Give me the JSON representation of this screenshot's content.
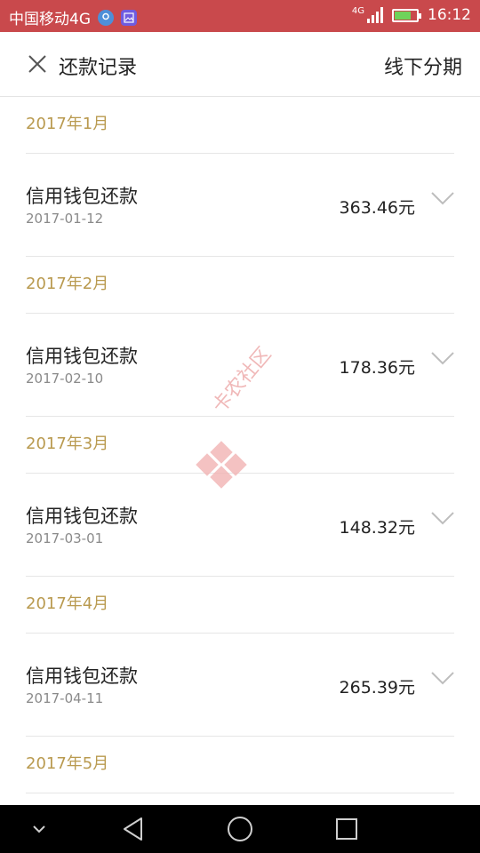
{
  "status_bar": {
    "carrier": "中国移动4G",
    "network": "4G",
    "time": "16:12"
  },
  "header": {
    "title": "还款记录",
    "right_link": "线下分期"
  },
  "sections": [
    {
      "month": "2017年1月",
      "records": [
        {
          "title": "信用钱包还款",
          "date": "2017-01-12",
          "amount": "363.46元"
        }
      ]
    },
    {
      "month": "2017年2月",
      "records": [
        {
          "title": "信用钱包还款",
          "date": "2017-02-10",
          "amount": "178.36元"
        }
      ]
    },
    {
      "month": "2017年3月",
      "records": [
        {
          "title": "信用钱包还款",
          "date": "2017-03-01",
          "amount": "148.32元"
        }
      ]
    },
    {
      "month": "2017年4月",
      "records": [
        {
          "title": "信用钱包还款",
          "date": "2017-04-11",
          "amount": "265.39元"
        }
      ]
    },
    {
      "month": "2017年5月",
      "records": []
    }
  ],
  "watermark": {
    "text": "卡农社区"
  },
  "colors": {
    "status_bar": "#c9494c",
    "month_text": "#b99a4f",
    "divider": "#e6e6e6"
  },
  "icons": {
    "close": "close-icon",
    "expand": "chevron-down-icon",
    "back": "back-triangle-icon",
    "home": "home-circle-icon",
    "recents": "recents-square-icon"
  }
}
